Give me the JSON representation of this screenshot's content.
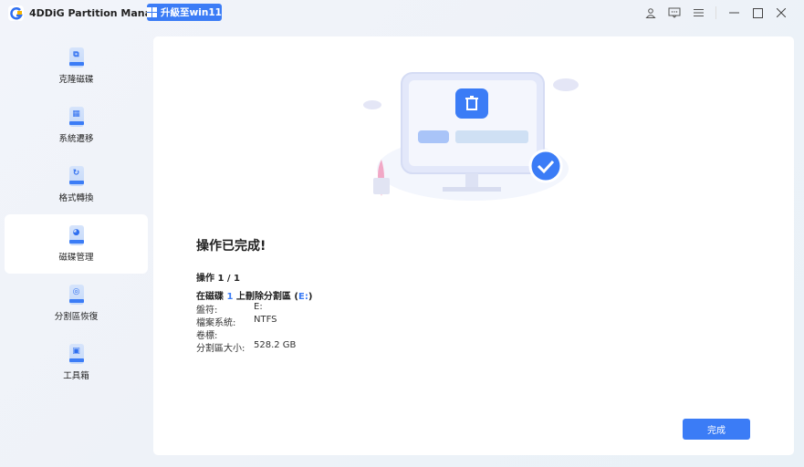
{
  "app": {
    "title": "4DDiG Partition Manager",
    "upgrade_label": "升級至win11"
  },
  "window_icons": [
    "user-icon",
    "feedback-icon",
    "menu-icon",
    "minimize-icon",
    "maximize-icon",
    "close-icon"
  ],
  "sidebar": {
    "items": [
      {
        "label": "克隆磁碟",
        "icon": "clone-icon"
      },
      {
        "label": "系統遷移",
        "icon": "migrate-icon"
      },
      {
        "label": "格式轉換",
        "icon": "convert-icon"
      },
      {
        "label": "磁碟管理",
        "icon": "disk-manage-icon",
        "active": true
      },
      {
        "label": "分割區恢復",
        "icon": "recovery-icon"
      },
      {
        "label": "工具箱",
        "icon": "toolbox-icon"
      }
    ]
  },
  "main": {
    "heading": "操作已完成!",
    "operation": "操作 1 / 1",
    "desc_pre": "在磁碟 ",
    "disk_num": "1",
    "desc_mid": " 上刪除分割區  (",
    "drive": "E:",
    "desc_post": ")",
    "details": [
      {
        "label": "盤符:",
        "value": "E:"
      },
      {
        "label": "檔案系統:",
        "value": "NTFS"
      },
      {
        "label": "卷標:",
        "value": ""
      },
      {
        "label": "分割區大小:",
        "value": "528.2 GB"
      }
    ],
    "done_label": "完成"
  },
  "colors": {
    "accent": "#3b7cf6"
  }
}
